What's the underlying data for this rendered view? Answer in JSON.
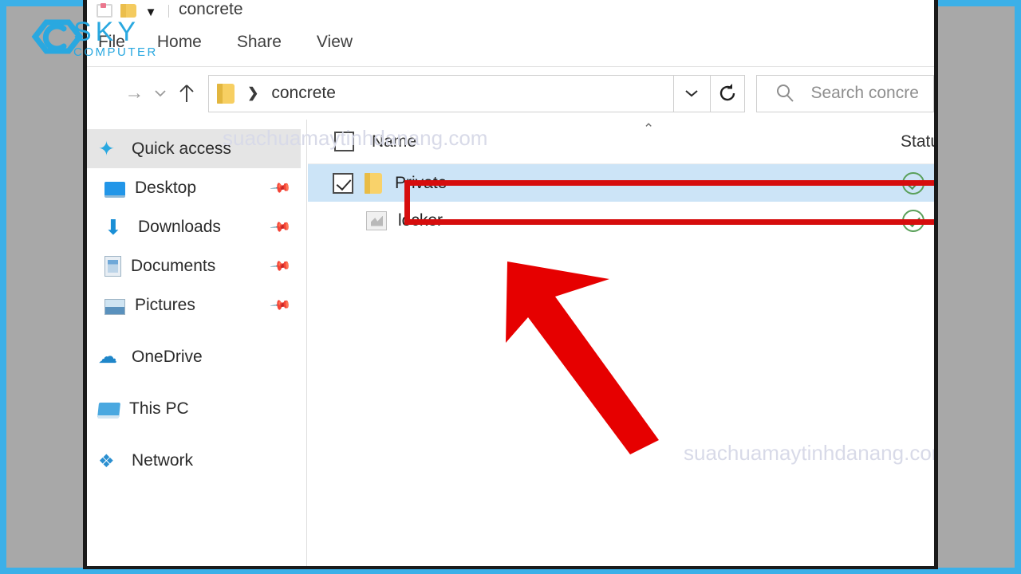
{
  "watermark": {
    "site": "suachuamaytinhdanang.com",
    "logo_primary": "SKY",
    "logo_secondary": "COMPUTER",
    "logo_color": "#29a8e0"
  },
  "window": {
    "title": "concrete",
    "quick_access_toolbar": [
      {
        "name": "properties-icon",
        "glyph": "pin"
      },
      {
        "name": "new-folder-icon",
        "glyph": "folder"
      },
      {
        "name": "customize-qat-chevron",
        "glyph": "▼"
      }
    ]
  },
  "ribbon": {
    "tabs": [
      {
        "label": "File",
        "active": false
      },
      {
        "label": "Home",
        "active": true
      },
      {
        "label": "Share",
        "active": false
      },
      {
        "label": "View",
        "active": false
      }
    ]
  },
  "navbar": {
    "back_icon": "→",
    "recent_locations_icon": "⌄",
    "up_icon": "↑",
    "breadcrumb_separator": "❯",
    "path": "concrete",
    "dropdown_icon": "⌄",
    "refresh_icon": "refresh",
    "search": {
      "placeholder": "Search concre",
      "icon": "search-icon"
    }
  },
  "sidebar": {
    "items": [
      {
        "label": "Quick access",
        "icon": "star-icon",
        "selected": true,
        "pinned": false,
        "indent": false
      },
      {
        "label": "Desktop",
        "icon": "desktop-icon",
        "selected": false,
        "pinned": true,
        "indent": true
      },
      {
        "label": "Downloads",
        "icon": "download-icon",
        "selected": false,
        "pinned": true,
        "indent": true
      },
      {
        "label": "Documents",
        "icon": "document-icon",
        "selected": false,
        "pinned": true,
        "indent": true
      },
      {
        "label": "Pictures",
        "icon": "picture-icon",
        "selected": false,
        "pinned": true,
        "indent": true
      },
      {
        "label": "OneDrive",
        "icon": "cloud-icon",
        "selected": false,
        "pinned": false,
        "indent": false
      },
      {
        "label": "This PC",
        "icon": "pc-icon",
        "selected": false,
        "pinned": false,
        "indent": false
      },
      {
        "label": "Network",
        "icon": "network-icon",
        "selected": false,
        "pinned": false,
        "indent": false
      }
    ],
    "pin_glyph": "📌"
  },
  "filelist": {
    "columns": [
      {
        "label": "Name",
        "sorted": true,
        "sort_glyph": "⌃"
      },
      {
        "label": "Status",
        "sorted": false,
        "sort_glyph": ""
      }
    ],
    "rows": [
      {
        "name": "Private",
        "type": "folder",
        "icon": "folder-icon",
        "checked": true,
        "selected": true,
        "highlighted": true,
        "status": "available-offline"
      },
      {
        "name": "locker",
        "type": "file",
        "icon": "file-icon",
        "checked": false,
        "selected": false,
        "highlighted": false,
        "status": "available-offline"
      }
    ]
  },
  "annotations": {
    "highlight_box_color": "#d60d0d",
    "arrow_color": "#e60000",
    "arrow_points_to": "Private"
  },
  "colors": {
    "outer_border": "#3cb0e8",
    "backdrop": "#a8a8a8",
    "selection": "#cce4f7",
    "sidebar_selection": "#e5e5e5",
    "status_ok": "#5aa05a"
  }
}
